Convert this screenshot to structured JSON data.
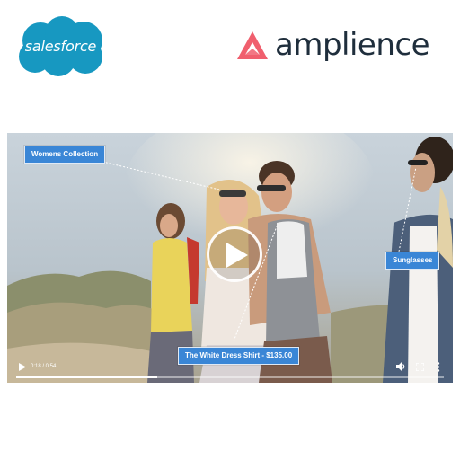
{
  "salesforce": {
    "label": "salesforce",
    "color": "#1798c1"
  },
  "amplience": {
    "label": "amplience",
    "mark_color": "#f05f6e",
    "text_color": "#1f2e3c"
  },
  "video": {
    "current_time": "0:18 / 0:54",
    "progress": 0.33,
    "hotspots": {
      "womens": "Womens Collection",
      "sunglasses": "Sunglasses",
      "shirt": "The White Dress Shirt - $135.00"
    },
    "hotspot_color": "#3a86d6",
    "icons": {
      "play": "play-icon",
      "big_play": "play-circle-icon",
      "volume": "volume-icon",
      "fullscreen": "fullscreen-icon",
      "more": "more-vertical-icon"
    }
  }
}
